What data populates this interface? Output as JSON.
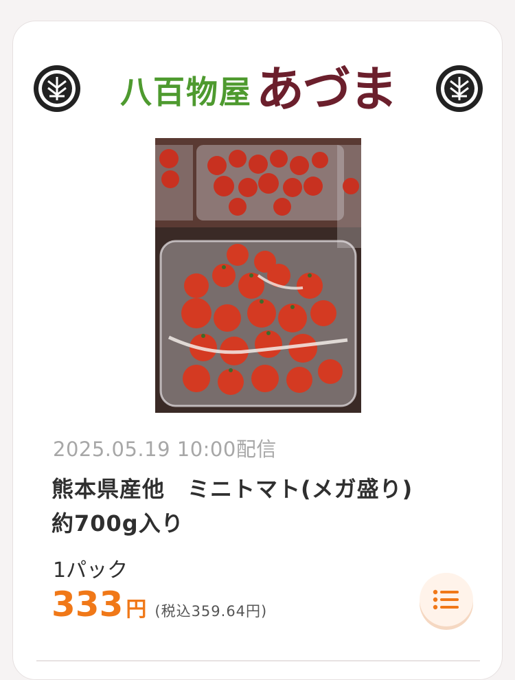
{
  "brand": {
    "name_green": "八百物屋",
    "name_red": "あづま",
    "crest_icon": "family-crest-icon",
    "colors": {
      "green": "#4e9a2f",
      "red": "#6b1f2c"
    }
  },
  "product": {
    "image_alt": "ミニトマト",
    "date": "2025.05.19 10:00配信",
    "title_line1": "熊本県産他　ミニトマト(メガ盛り)",
    "title_line2": "約700g入り",
    "unit": "1パック",
    "price": "333",
    "currency": "円",
    "tax_note": "(税込359.64円)"
  },
  "actions": {
    "list_icon": "list-icon"
  },
  "colors": {
    "accent": "#f07818",
    "background": "#f6f3f3"
  }
}
